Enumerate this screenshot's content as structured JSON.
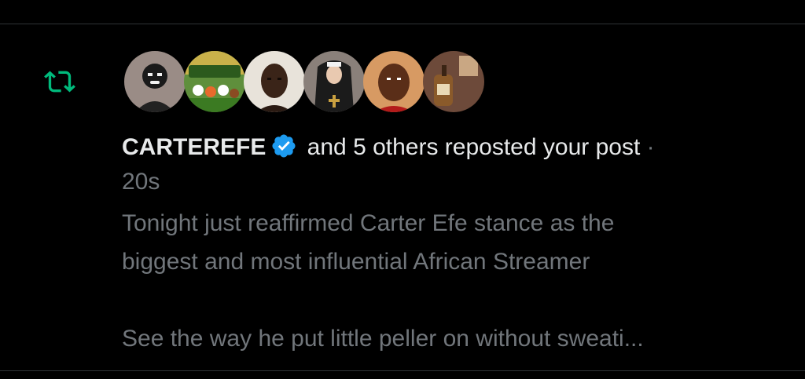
{
  "notification": {
    "type_icon": "repost-icon",
    "avatars": [
      {
        "name": "avatar-1",
        "bg": "#8a7a72"
      },
      {
        "name": "avatar-2",
        "bg": "#3f6a2c"
      },
      {
        "name": "avatar-3",
        "bg": "#dcd6cc"
      },
      {
        "name": "avatar-4",
        "bg": "#6b6460"
      },
      {
        "name": "avatar-5",
        "bg": "#c9905f"
      },
      {
        "name": "avatar-6",
        "bg": "#7c5e4f"
      }
    ],
    "actor_name": "CARTEREFE",
    "action_text": " and 5 others reposted your post",
    "separator": " ·",
    "time": "20s",
    "post_lines": [
      "Tonight just reaffirmed Carter Efe stance as the",
      "biggest and most influential African Streamer",
      "See the way he put little peller on without sweati..."
    ]
  },
  "colors": {
    "background": "#000000",
    "primary_text": "#e7e9ea",
    "secondary_text": "#71767b",
    "repost_green": "#00ba7c",
    "verified_blue": "#1d9bf0",
    "divider": "#2f3336"
  }
}
